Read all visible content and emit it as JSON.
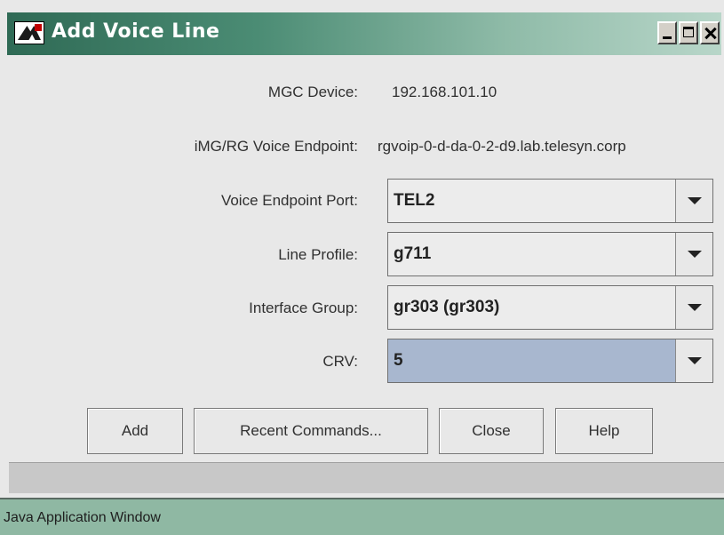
{
  "window": {
    "title": "Add Voice Line",
    "icon": "allied-telesyn-app-icon",
    "controls": [
      "minimize-icon",
      "maximize-icon",
      "close-icon"
    ]
  },
  "form": {
    "mgc_device": {
      "label": "MGC Device:",
      "value": "192.168.101.10"
    },
    "voice_endpoint": {
      "label": "iMG/RG Voice Endpoint:",
      "value": "rgvoip-0-d-da-0-2-d9.lab.telesyn.corp"
    },
    "endpoint_port": {
      "label": "Voice Endpoint Port:",
      "value": "TEL2"
    },
    "line_profile": {
      "label": "Line Profile:",
      "value": "g711"
    },
    "interface_group": {
      "label": "Interface Group:",
      "value": "gr303 (gr303)"
    },
    "crv": {
      "label": "CRV:",
      "value": "5"
    }
  },
  "buttons": {
    "add": "Add",
    "recent_commands": "Recent Commands...",
    "close": "Close",
    "help": "Help"
  },
  "status_bar": {
    "text": "Java Application Window"
  },
  "colors": {
    "title_bar_start": "#2f6a55",
    "title_bar_end": "#b8d6c9",
    "selected_combo": "#a8b7cf",
    "status_bar": "#8fb8a3"
  }
}
